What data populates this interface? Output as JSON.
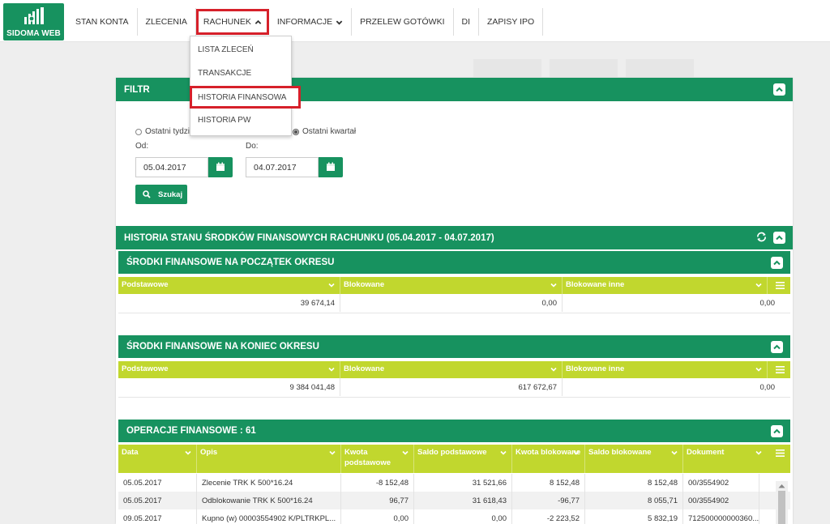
{
  "app": {
    "logo_text": "SIDOMA WEB"
  },
  "nav": {
    "items": [
      {
        "label": "STAN KONTA"
      },
      {
        "label": "ZLECENIA"
      },
      {
        "label": "RACHUNEK"
      },
      {
        "label": "INFORMACJE"
      },
      {
        "label": "PRZELEW GOTÓWKI"
      },
      {
        "label": "DI"
      },
      {
        "label": "ZAPISY IPO"
      }
    ],
    "dropdown": [
      {
        "label": "LISTA ZLECEŃ"
      },
      {
        "label": "TRANSAKCJE"
      },
      {
        "label": "HISTORIA FINANSOWA"
      },
      {
        "label": "HISTORIA PW"
      }
    ]
  },
  "filter": {
    "title": "FILTR",
    "radio_last_week": "Ostatni tydzień",
    "radio_last_quarter": "Ostatni kwartał",
    "from_label": "Od:",
    "to_label": "Do:",
    "from_value": "05.04.2017",
    "to_value": "04.07.2017",
    "search_label": "Szukaj"
  },
  "history": {
    "title": "HISTORIA STANU ŚRODKÓW FINANSOWYCH RACHUNKU (05.04.2017 - 04.07.2017)"
  },
  "start": {
    "title": "ŚRODKI FINANSOWE NA POCZĄTEK OKRESU",
    "columns": [
      "Podstawowe",
      "Blokowane",
      "Blokowane inne"
    ],
    "row": [
      "39 674,14",
      "0,00",
      "0,00"
    ]
  },
  "end": {
    "title": "ŚRODKI FINANSOWE NA KONIEC OKRESU",
    "columns": [
      "Podstawowe",
      "Blokowane",
      "Blokowane inne"
    ],
    "row": [
      "9 384 041,48",
      "617 672,67",
      "0,00"
    ]
  },
  "operations": {
    "title": "OPERACJE FINANSOWE : 61",
    "columns": [
      "Data",
      "Opis",
      "Kwota podstawowe",
      "Saldo podstawowe",
      "Kwota blokowane",
      "Saldo blokowane",
      "Dokument"
    ],
    "rows": [
      [
        "05.05.2017",
        "Zlecenie TRK K 500*16.24",
        "-8 152,48",
        "31 521,66",
        "8 152,48",
        "8 152,48",
        "00/3554902"
      ],
      [
        "05.05.2017",
        "Odblokowanie TRK K 500*16.24",
        "96,77",
        "31 618,43",
        "-96,77",
        "8 055,71",
        "00/3554902"
      ],
      [
        "09.05.2017",
        "Kupno (w) 00003554902 K/PLTRKPL...",
        "0,00",
        "0,00",
        "-2 223,52",
        "5 832,19",
        "712500000000360..."
      ]
    ]
  }
}
